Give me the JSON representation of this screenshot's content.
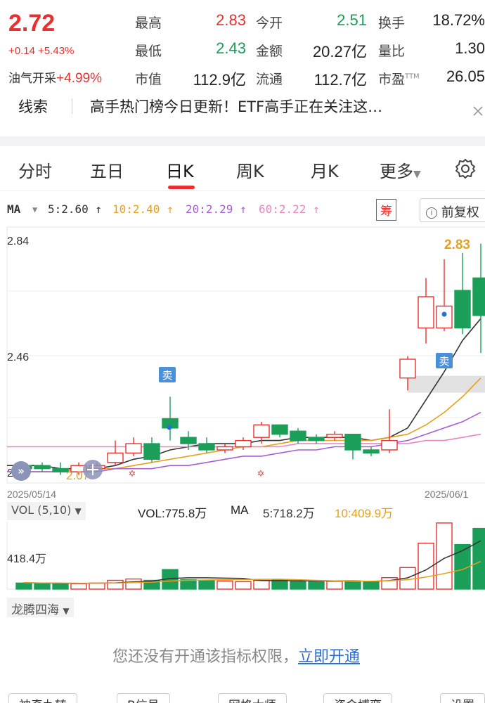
{
  "quote": {
    "price": "2.72",
    "change": "+0.14 +5.43%",
    "sector_name": "油气开采",
    "sector_pct": "+4.99%",
    "fields": [
      {
        "label": "最高",
        "value": "2.83",
        "tone": "red"
      },
      {
        "label": "今开",
        "value": "2.51",
        "tone": "green"
      },
      {
        "label": "换手",
        "value": "18.72%",
        "tone": ""
      },
      {
        "label": "最低",
        "value": "2.43",
        "tone": "green"
      },
      {
        "label": "金额",
        "value": "20.27亿",
        "tone": ""
      },
      {
        "label": "量比",
        "value": "1.30",
        "tone": ""
      },
      {
        "label": "市值",
        "value": "112.9亿",
        "tone": ""
      },
      {
        "label": "流通",
        "value": "112.7亿",
        "tone": ""
      },
      {
        "label": "市盈",
        "value": "26.05",
        "tone": ""
      }
    ],
    "ttm": "TTM"
  },
  "news": {
    "tag": "线索",
    "text": "高手热门榜今日更新！ETF高手正在关注这…"
  },
  "tabs": [
    {
      "label": "分时",
      "active": false
    },
    {
      "label": "五日",
      "active": false
    },
    {
      "label": "日K",
      "active": true
    },
    {
      "label": "周K",
      "active": false
    },
    {
      "label": "月K",
      "active": false
    },
    {
      "label": "更多",
      "active": false
    }
  ],
  "ma_legend": {
    "title": "MA",
    "items": [
      {
        "text": "5:2.60 ↑",
        "color": "#333333"
      },
      {
        "text": "10:2.40 ↑",
        "color": "#e6a11c"
      },
      {
        "text": "20:2.29 ↑",
        "color": "#a35fd3"
      },
      {
        "text": "60:2.22 ↑",
        "color": "#e886c0"
      }
    ],
    "chip_label": "筹",
    "adjust_label": "前复权"
  },
  "chart_data": [
    {
      "type": "candlestick",
      "y_ticks": [
        "2.84",
        "2.46",
        "2.08"
      ],
      "ylim": [
        2.08,
        2.84
      ],
      "x_start_label": "2025/05/14",
      "x_end_label": "2025/06/1",
      "high_label": "2.83",
      "low_label": "2.07",
      "sell_labels": [
        "卖",
        "卖"
      ],
      "candles": [
        {
          "o": 2.12,
          "c": 2.11,
          "h": 2.13,
          "l": 2.1
        },
        {
          "o": 2.12,
          "c": 2.11,
          "h": 2.13,
          "l": 2.1
        },
        {
          "o": 2.11,
          "c": 2.1,
          "h": 2.13,
          "l": 2.09
        },
        {
          "o": 2.1,
          "c": 2.12,
          "h": 2.13,
          "l": 2.09
        },
        {
          "o": 2.11,
          "c": 2.12,
          "h": 2.13,
          "l": 2.1
        },
        {
          "o": 2.13,
          "c": 2.16,
          "h": 2.2,
          "l": 2.12
        },
        {
          "o": 2.16,
          "c": 2.19,
          "h": 2.21,
          "l": 2.15
        },
        {
          "o": 2.19,
          "c": 2.14,
          "h": 2.21,
          "l": 2.13
        },
        {
          "o": 2.27,
          "c": 2.24,
          "h": 2.34,
          "l": 2.2
        },
        {
          "o": 2.21,
          "c": 2.19,
          "h": 2.23,
          "l": 2.17
        },
        {
          "o": 2.19,
          "c": 2.17,
          "h": 2.21,
          "l": 2.16
        },
        {
          "o": 2.17,
          "c": 2.18,
          "h": 2.19,
          "l": 2.16
        },
        {
          "o": 2.18,
          "c": 2.2,
          "h": 2.21,
          "l": 2.17
        },
        {
          "o": 2.21,
          "c": 2.25,
          "h": 2.26,
          "l": 2.19
        },
        {
          "o": 2.25,
          "c": 2.22,
          "h": 2.25,
          "l": 2.21
        },
        {
          "o": 2.23,
          "c": 2.2,
          "h": 2.24,
          "l": 2.19
        },
        {
          "o": 2.21,
          "c": 2.2,
          "h": 2.22,
          "l": 2.19
        },
        {
          "o": 2.21,
          "c": 2.22,
          "h": 2.23,
          "l": 2.2
        },
        {
          "o": 2.22,
          "c": 2.17,
          "h": 2.22,
          "l": 2.14
        },
        {
          "o": 2.17,
          "c": 2.16,
          "h": 2.18,
          "l": 2.15
        },
        {
          "o": 2.17,
          "c": 2.2,
          "h": 2.3,
          "l": 2.16
        },
        {
          "o": 2.4,
          "c": 2.46,
          "h": 2.47,
          "l": 2.36
        },
        {
          "o": 2.56,
          "c": 2.66,
          "h": 2.72,
          "l": 2.51
        },
        {
          "o": 2.56,
          "c": 2.63,
          "h": 2.78,
          "l": 2.55
        },
        {
          "o": 2.68,
          "c": 2.56,
          "h": 2.8,
          "l": 2.54
        },
        {
          "o": 2.72,
          "c": 2.6,
          "h": 2.83,
          "l": 2.48
        }
      ],
      "ma_series": [
        {
          "name": "MA5",
          "color": "#333333",
          "values": [
            2.12,
            2.12,
            2.11,
            2.11,
            2.11,
            2.12,
            2.14,
            2.15,
            2.17,
            2.18,
            2.19,
            2.19,
            2.19,
            2.2,
            2.2,
            2.21,
            2.21,
            2.21,
            2.21,
            2.2,
            2.21,
            2.24,
            2.33,
            2.42,
            2.52,
            2.59
          ]
        },
        {
          "name": "MA10",
          "color": "#e6a11c",
          "values": [
            2.1,
            2.1,
            2.1,
            2.11,
            2.11,
            2.11,
            2.12,
            2.13,
            2.14,
            2.15,
            2.16,
            2.17,
            2.18,
            2.18,
            2.19,
            2.2,
            2.2,
            2.2,
            2.2,
            2.2,
            2.21,
            2.22,
            2.25,
            2.29,
            2.34,
            2.4
          ]
        },
        {
          "name": "MA20",
          "color": "#a35fd3",
          "values": [
            2.1,
            2.1,
            2.1,
            2.1,
            2.1,
            2.11,
            2.11,
            2.11,
            2.12,
            2.12,
            2.13,
            2.14,
            2.15,
            2.15,
            2.16,
            2.17,
            2.17,
            2.18,
            2.18,
            2.18,
            2.19,
            2.2,
            2.22,
            2.24,
            2.26,
            2.29
          ]
        },
        {
          "name": "MA60",
          "color": "#e886c0",
          "values": [
            2.18,
            2.18,
            2.18,
            2.18,
            2.18,
            2.18,
            2.18,
            2.18,
            2.18,
            2.18,
            2.18,
            2.18,
            2.18,
            2.18,
            2.18,
            2.19,
            2.19,
            2.19,
            2.19,
            2.19,
            2.19,
            2.19,
            2.2,
            2.2,
            2.21,
            2.22
          ]
        }
      ]
    },
    {
      "type": "bar",
      "indicator": "VOL (5,10)",
      "vol_label": "VOL:775.8万",
      "ma_label": "MA",
      "ma5_label": "5:718.2万",
      "ma10_label": "10:409.9万",
      "y_tick": "418.4万",
      "ylim": [
        0,
        1000
      ],
      "volumes": [
        90,
        80,
        85,
        80,
        90,
        130,
        150,
        130,
        290,
        140,
        130,
        120,
        110,
        130,
        140,
        120,
        110,
        115,
        120,
        110,
        170,
        320,
        680,
        980,
        660,
        900
      ],
      "ma_series": [
        {
          "name": "MA5",
          "color": "#333333",
          "values": [
            95,
            90,
            88,
            85,
            85,
            93,
            107,
            117,
            158,
            168,
            168,
            162,
            158,
            126,
            126,
            124,
            122,
            123,
            121,
            115,
            126,
            167,
            284,
            456,
            570,
            718
          ]
        },
        {
          "name": "MA10",
          "color": "#e6a11c",
          "values": [
            95,
            92,
            90,
            88,
            87,
            90,
            96,
            103,
            120,
            130,
            135,
            140,
            142,
            145,
            147,
            140,
            130,
            122,
            118,
            118,
            124,
            140,
            178,
            230,
            290,
            410
          ]
        }
      ]
    }
  ],
  "indicator": {
    "name": "龙腾四海",
    "lock_text": "您还没有开通该指标权限，",
    "link_text": "立即开通"
  },
  "bottom_buttons": [
    "神奇九转",
    "B信号",
    "网格大师",
    "资金博弈",
    "设置"
  ],
  "colors": {
    "up": "#e93030",
    "down": "#1a9e58",
    "accent": "#e93030"
  }
}
